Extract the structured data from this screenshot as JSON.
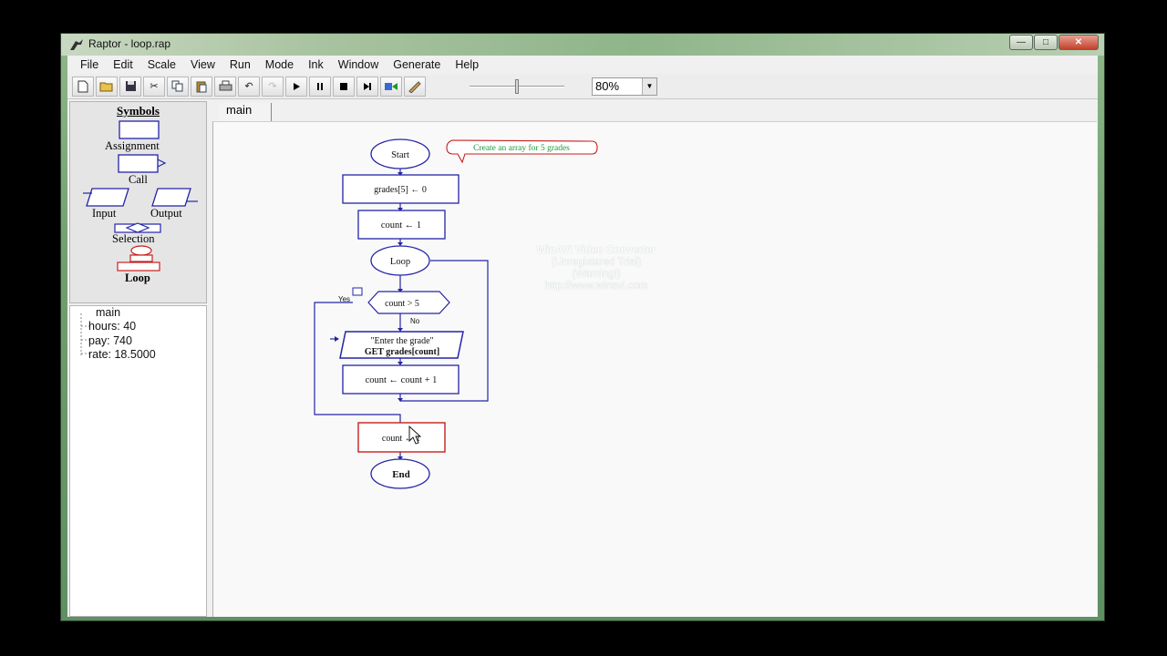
{
  "window": {
    "title": "Raptor - loop.rap",
    "controls": {
      "minimize": "—",
      "maximize": "□",
      "close": "✕"
    }
  },
  "menu": [
    "File",
    "Edit",
    "Scale",
    "View",
    "Run",
    "Mode",
    "Ink",
    "Window",
    "Generate",
    "Help"
  ],
  "toolbar": {
    "icons": [
      "new-file-icon",
      "open-folder-icon",
      "save-icon",
      "cut-icon",
      "copy-icon",
      "paste-icon",
      "print-icon",
      "undo-icon",
      "redo-icon",
      "play-icon",
      "pause-icon",
      "stop-icon",
      "step-icon",
      "step-into-icon",
      "pen-icon"
    ],
    "zoom": "80%"
  },
  "symbols": {
    "title": "Symbols",
    "assignment": "Assignment",
    "call": "Call",
    "input": "Input",
    "output": "Output",
    "selection": "Selection",
    "loop": "Loop"
  },
  "variables": {
    "root": "main",
    "items": [
      "hours: 40",
      "pay: 740",
      "rate: 18.5000"
    ]
  },
  "tabs": {
    "main": "main"
  },
  "flowchart": {
    "start": "Start",
    "comment": "Create an array for 5 grades",
    "assign1": "grades[5] ← 0",
    "assign2": "count ← 1",
    "loop": "Loop",
    "condition": "count > 5",
    "yes": "Yes",
    "no": "No",
    "input_prompt": "\"Enter the grade\"",
    "input_get": "GET grades[count]",
    "increment": "count ← count + 1",
    "after": "count ← 1",
    "end": "End"
  },
  "watermark": {
    "line1": "WinAVI Video Converter",
    "line2": "(Unregistered Trial)",
    "line3": "(Warning!)",
    "line4": "http://www.winavi.com"
  },
  "colors": {
    "flow_blue": "#2424a8",
    "selected_red": "#c81e1e",
    "comment_green": "#1e9a3c"
  }
}
